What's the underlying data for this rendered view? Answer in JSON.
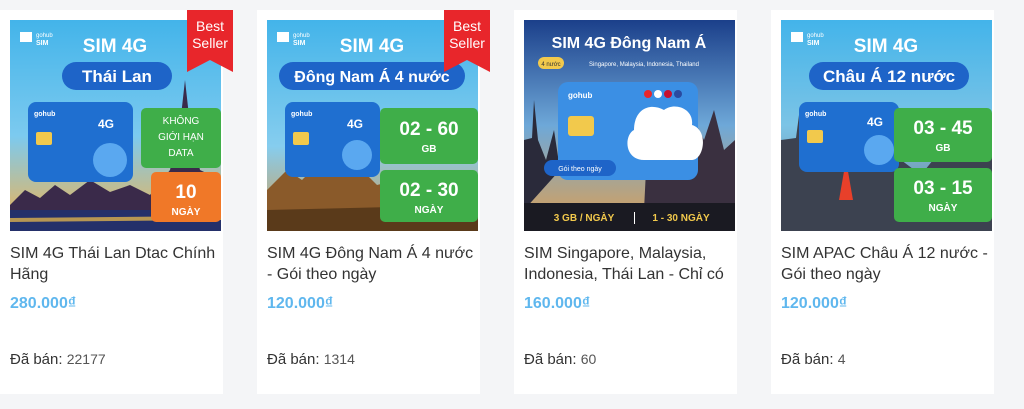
{
  "products": [
    {
      "title": "SIM 4G Thái Lan Dtac Chính Hãng",
      "price": "280.000₫",
      "sold_label": "Đã bán:",
      "sold_count": "22177",
      "badge": [
        "Best",
        "Seller"
      ],
      "image": {
        "brand": "gohub",
        "brand_sub": "SIM",
        "headline": "SIM 4G",
        "destination": "Thái Lan",
        "card_brand": "gohub",
        "card_4g": "4G",
        "box1_lines": [
          "KHÔNG",
          "GIỚI HẠN",
          "DATA"
        ],
        "box2_value": "10",
        "box2_unit": "NGÀY"
      }
    },
    {
      "title": "SIM 4G Đông Nam Á 4 nước - Gói theo ngày",
      "price": "120.000₫",
      "sold_label": "Đã bán:",
      "sold_count": "1314",
      "badge": [
        "Best",
        "Seller"
      ],
      "image": {
        "brand": "gohub",
        "brand_sub": "SIM",
        "headline": "SIM 4G",
        "destination": "Đông Nam Á 4 nước",
        "card_brand": "gohub",
        "card_4g": "4G",
        "box1_value": "02 - 60",
        "box1_unit": "GB",
        "box2_value": "02 - 30",
        "box2_unit": "NGÀY"
      }
    },
    {
      "title": "SIM Singapore, Malaysia, Indonesia, Thái Lan - Chỉ có",
      "price": "160.000₫",
      "sold_label": "Đã bán:",
      "sold_count": "60",
      "image": {
        "headline": "SIM 4G Đông Nam Á",
        "tag": "4 nước",
        "countries": "Singapore, Malaysia, Indonesia, Thailand",
        "card_brand": "gohub",
        "pill": "Gói theo ngày",
        "bottom_left": "3 GB / NGÀY",
        "bottom_right": "1 - 30 NGÀY"
      }
    },
    {
      "title": "SIM APAC Châu Á 12 nước - Gói theo ngày",
      "price": "120.000₫",
      "sold_label": "Đã bán:",
      "sold_count": "4",
      "image": {
        "brand": "gohub",
        "brand_sub": "SIM",
        "headline": "SIM 4G",
        "destination": "Châu Á 12 nước",
        "card_brand": "gohub",
        "card_4g": "4G",
        "box1_value": "03 - 45",
        "box1_unit": "GB",
        "box2_value": "03 - 15",
        "box2_unit": "NGÀY"
      }
    }
  ],
  "colors": {
    "price": "#5fb7ee",
    "ribbon": "#e8262b",
    "box_green": "#3fae49",
    "box_orange": "#f07828",
    "headline_blue": "#1e64c8",
    "sky_blue": "#4ab8ee"
  }
}
